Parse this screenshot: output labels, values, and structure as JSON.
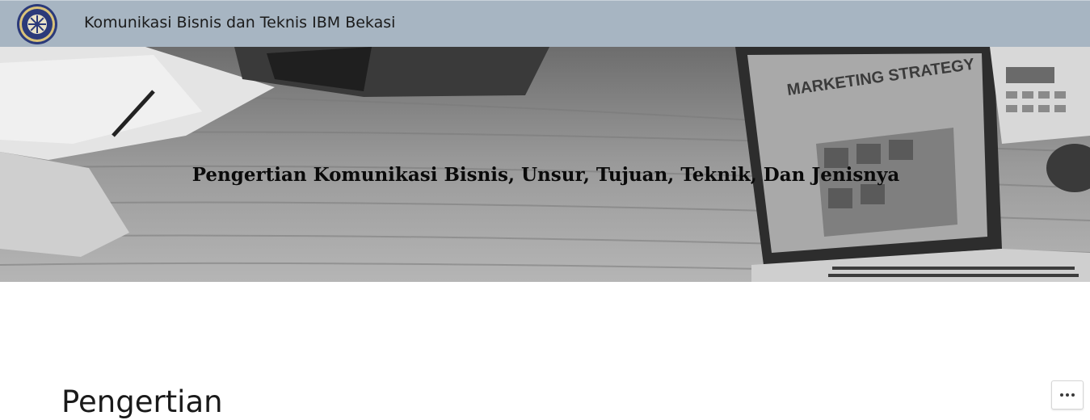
{
  "header": {
    "site_title": "Komunikasi Bisnis dan Teknis IBM Bekasi",
    "logo_icon": "university-seal-icon",
    "background_color": "#a7b5c2"
  },
  "hero": {
    "title": "Pengertian Komunikasi Bisnis, Unsur, Tujuan, Teknik, Dan Jenisnya",
    "screen_heading": "MARKETING STRATEGY",
    "image_description_icon": "desk-laptop-image"
  },
  "content": {
    "heading": "Pengertian"
  },
  "actions": {
    "more_icon": "more-options-icon"
  }
}
